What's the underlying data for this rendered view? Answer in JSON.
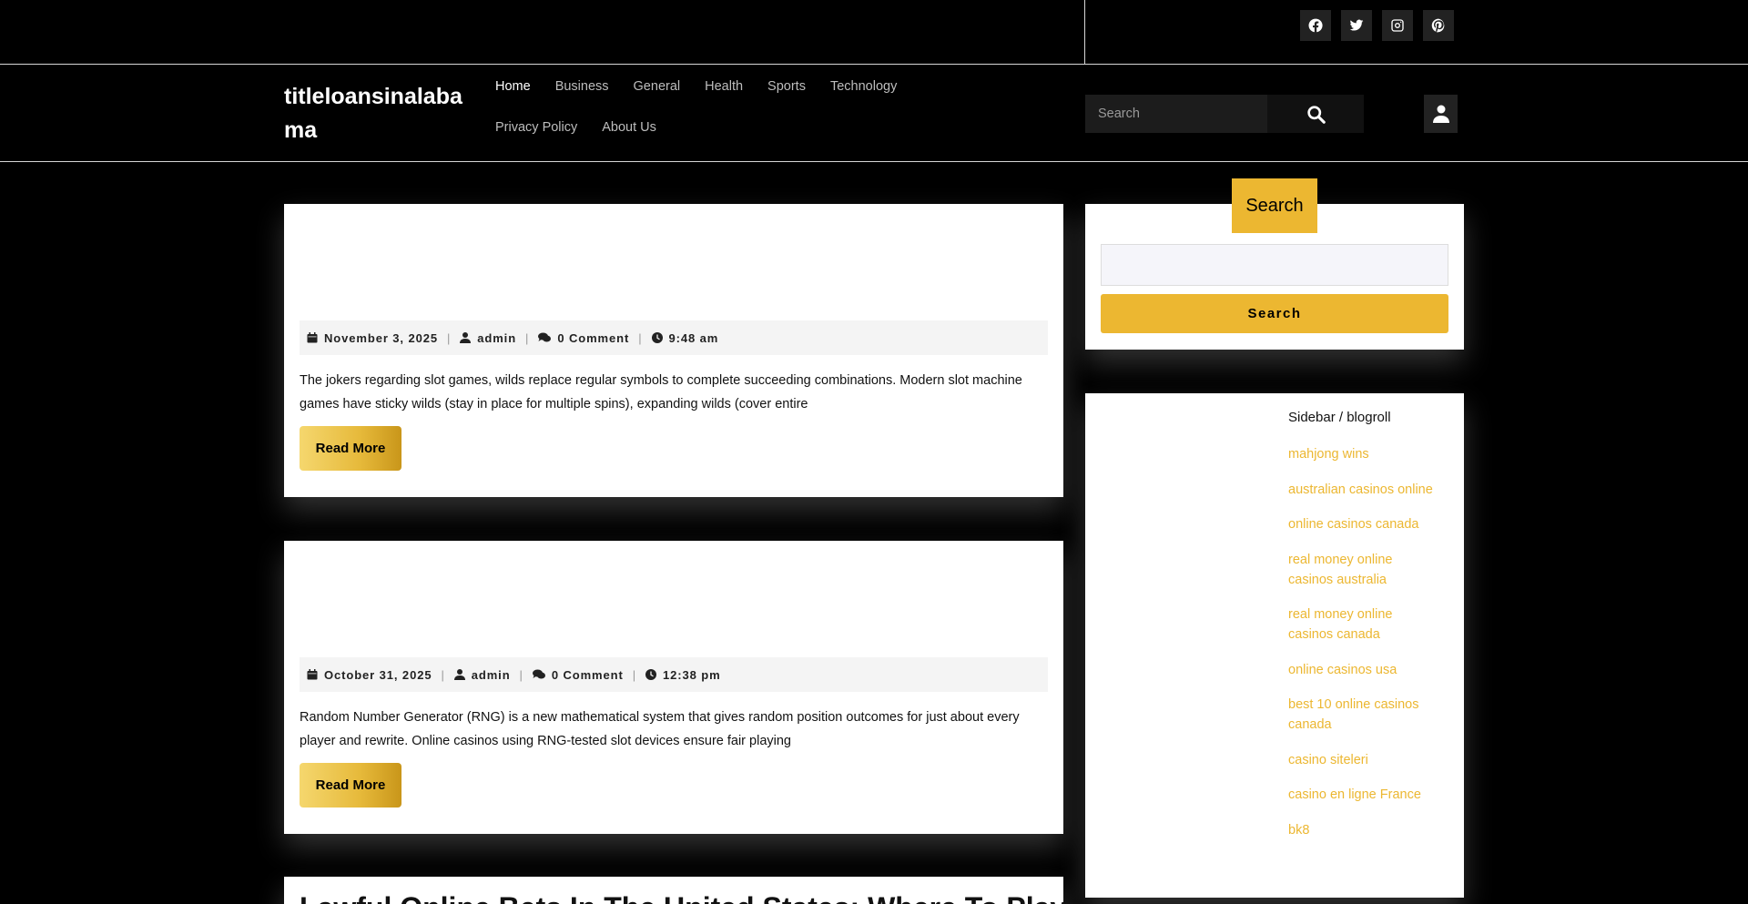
{
  "topbar": {
    "socials": [
      {
        "icon": "facebook-icon"
      },
      {
        "icon": "twitter-icon"
      },
      {
        "icon": "instagram-icon"
      },
      {
        "icon": "pinterest-icon"
      }
    ]
  },
  "header": {
    "brand": "titleloansinalabama",
    "nav": [
      "Home",
      "Business",
      "General",
      "Health",
      "Sports",
      "Technology",
      "Privacy Policy",
      "About Us"
    ],
    "active_nav": "Home",
    "search_placeholder": "Search"
  },
  "posts": [
    {
      "date": "November 3, 2025",
      "author": "admin",
      "comments": "0 Comment",
      "time": "9:48 am",
      "excerpt": "The jokers regarding slot games, wilds replace regular symbols to complete succeeding combinations. Modern slot machine games have sticky wilds (stay in place for multiple spins), expanding wilds (cover entire",
      "read_more": "Read More"
    },
    {
      "date": "October 31, 2025",
      "author": "admin",
      "comments": "0 Comment",
      "time": "12:38 pm",
      "excerpt": "Random Number Generator (RNG) is a new mathematical system that gives random position outcomes for just about every player and rewrite. Online casinos using RNG-tested slot devices ensure fair playing",
      "read_more": "Read More"
    },
    {
      "title": "Lawful Online Bets In The United States: Where To Play"
    }
  ],
  "sidebar": {
    "search_title": "Search",
    "search_button": "Search",
    "blogroll_title": "Sidebar / blogroll",
    "links": [
      "mahjong wins",
      "australian casinos online",
      "online casinos canada",
      "real money online casinos australia",
      "real money online casinos canada",
      "online casinos usa",
      "best 10 online casinos canada",
      "casino siteleri",
      "casino en ligne France",
      "bk8"
    ]
  },
  "colors": {
    "accent": "#ecb731",
    "background": "#000000"
  }
}
